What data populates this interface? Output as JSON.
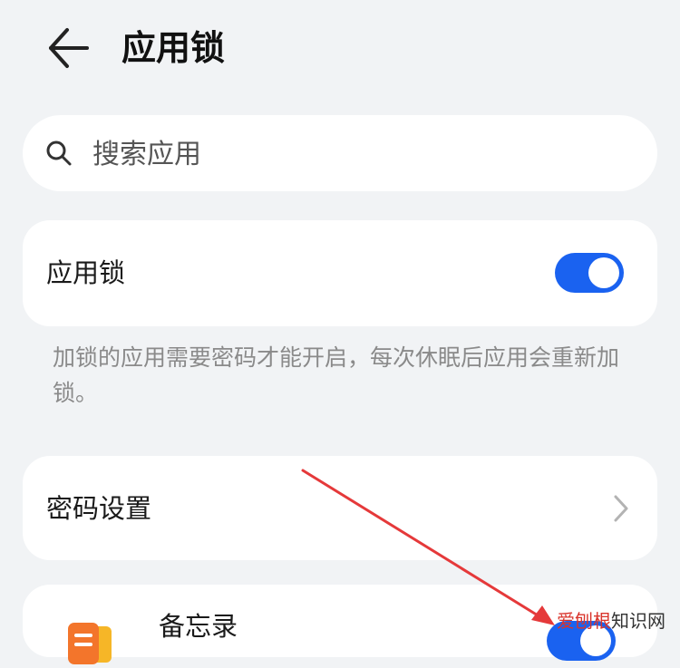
{
  "header": {
    "title": "应用锁",
    "back_icon": "back-arrow-icon"
  },
  "search": {
    "placeholder": "搜索应用",
    "icon": "search-icon"
  },
  "app_lock": {
    "label": "应用锁",
    "enabled": true
  },
  "description": "加锁的应用需要密码才能开启，每次休眠后应用会重新加锁。",
  "password_settings": {
    "label": "密码设置",
    "icon": "chevron-right-icon"
  },
  "apps": [
    {
      "name": "备忘录",
      "icon": "memo-app-icon",
      "locked": true
    }
  ],
  "watermark": {
    "part1": "爱刨根",
    "part2": "知识网"
  },
  "colors": {
    "accent": "#1a62f0",
    "background": "#f1f3f5",
    "card": "#ffffff",
    "annotation": "#e5393a"
  }
}
